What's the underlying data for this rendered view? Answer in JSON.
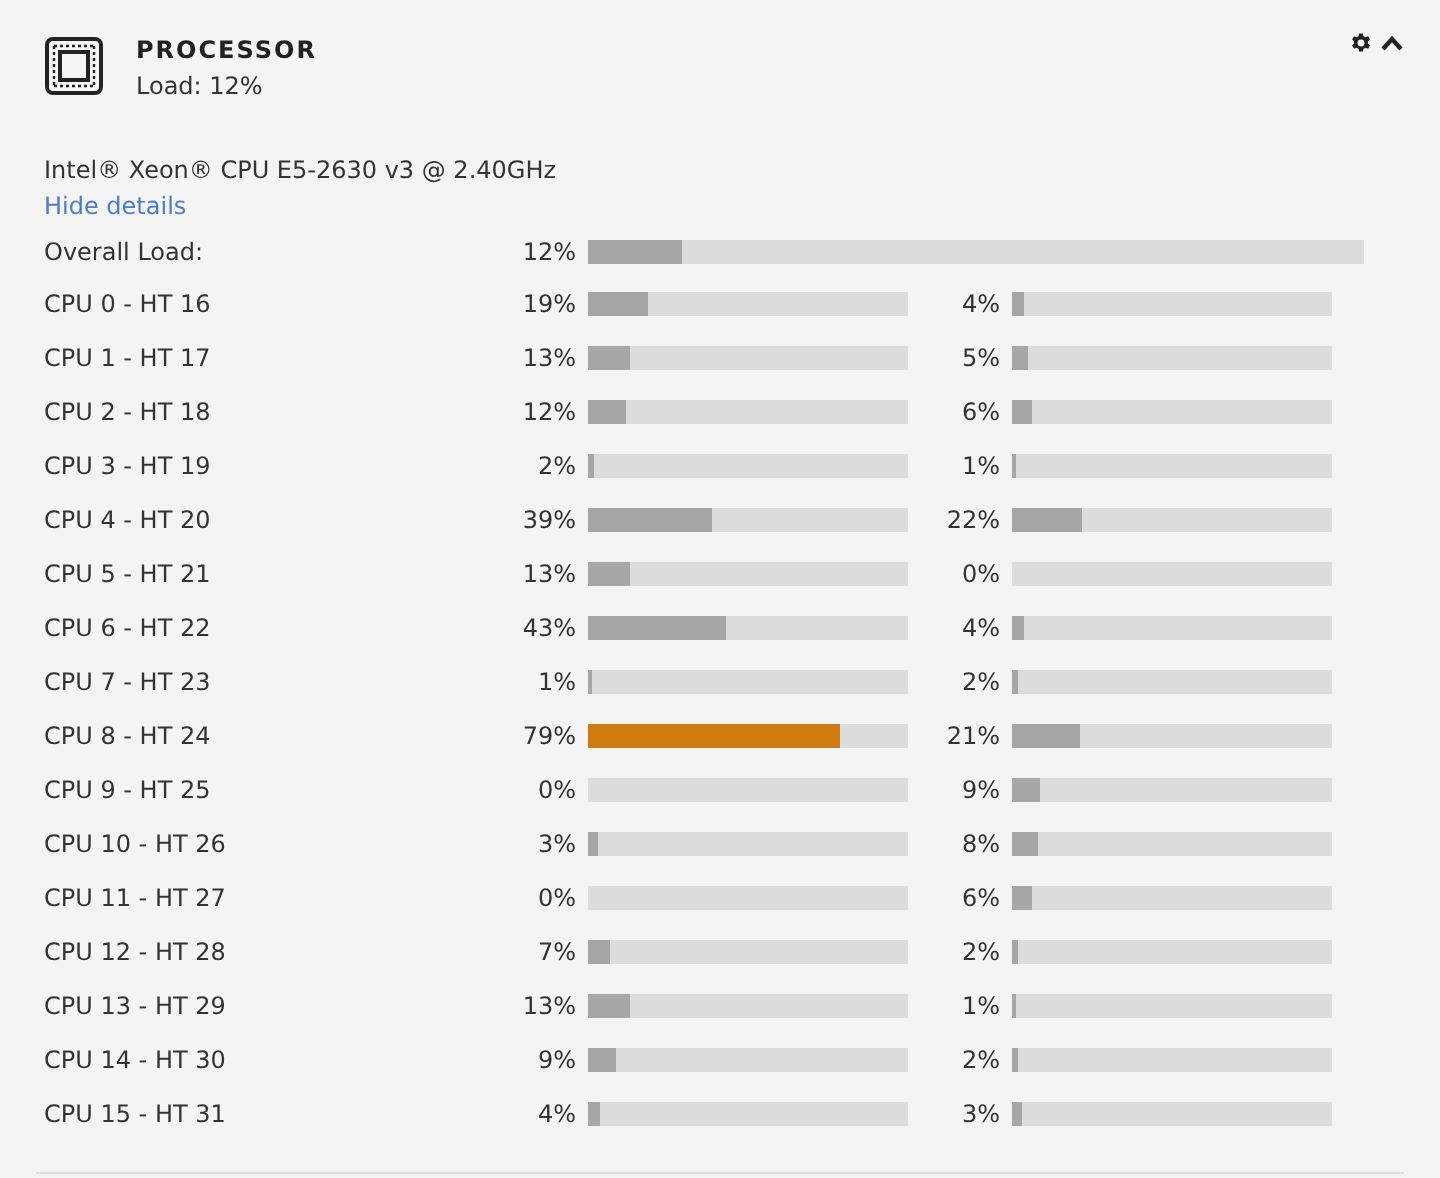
{
  "header": {
    "title": "PROCESSOR",
    "subtitle": "Load: 12%"
  },
  "cpu_model": "Intel® Xeon® CPU E5-2630 v3 @ 2.40GHz",
  "details_link": "Hide details",
  "overall": {
    "label": "Overall Load:",
    "reading": "12%",
    "level": 0.12
  },
  "cpus": [
    {
      "label": "CPU 0 - HT 16",
      "core": {
        "reading": "19%",
        "level": 0.19
      },
      "ht": {
        "reading": "4%",
        "level": 0.04
      }
    },
    {
      "label": "CPU 1 - HT 17",
      "core": {
        "reading": "13%",
        "level": 0.13
      },
      "ht": {
        "reading": "5%",
        "level": 0.05
      }
    },
    {
      "label": "CPU 2 - HT 18",
      "core": {
        "reading": "12%",
        "level": 0.12
      },
      "ht": {
        "reading": "6%",
        "level": 0.06
      }
    },
    {
      "label": "CPU 3 - HT 19",
      "core": {
        "reading": "2%",
        "level": 0.02
      },
      "ht": {
        "reading": "1%",
        "level": 0.01
      }
    },
    {
      "label": "CPU 4 - HT 20",
      "core": {
        "reading": "39%",
        "level": 0.39
      },
      "ht": {
        "reading": "22%",
        "level": 0.22
      }
    },
    {
      "label": "CPU 5 - HT 21",
      "core": {
        "reading": "13%",
        "level": 0.13
      },
      "ht": {
        "reading": "0%",
        "level": 0
      }
    },
    {
      "label": "CPU 6 - HT 22",
      "core": {
        "reading": "43%",
        "level": 0.43
      },
      "ht": {
        "reading": "4%",
        "level": 0.04
      }
    },
    {
      "label": "CPU 7 - HT 23",
      "core": {
        "reading": "1%",
        "level": 0.01
      },
      "ht": {
        "reading": "2%",
        "level": 0.02
      }
    },
    {
      "label": "CPU 8 - HT 24",
      "core": {
        "reading": "79%",
        "level": 0.79
      },
      "ht": {
        "reading": "21%",
        "level": 0.21
      }
    },
    {
      "label": "CPU 9 - HT 25",
      "core": {
        "reading": "0%",
        "level": 0
      },
      "ht": {
        "reading": "9%",
        "level": 0.09
      }
    },
    {
      "label": "CPU 10 - HT 26",
      "core": {
        "reading": "3%",
        "level": 0.03
      },
      "ht": {
        "reading": "8%",
        "level": 0.08
      }
    },
    {
      "label": "CPU 11 - HT 27",
      "core": {
        "reading": "0%",
        "level": 0
      },
      "ht": {
        "reading": "6%",
        "level": 0.06
      }
    },
    {
      "label": "CPU 12 - HT 28",
      "core": {
        "reading": "7%",
        "level": 0.07
      },
      "ht": {
        "reading": "2%",
        "level": 0.02
      }
    },
    {
      "label": "CPU 13 - HT 29",
      "core": {
        "reading": "13%",
        "level": 0.13
      },
      "ht": {
        "reading": "1%",
        "level": 0.01
      }
    },
    {
      "label": "CPU 14 - HT 30",
      "core": {
        "reading": "9%",
        "level": 0.09
      },
      "ht": {
        "reading": "2%",
        "level": 0.02
      }
    },
    {
      "label": "CPU 15 - HT 31",
      "core": {
        "reading": "4%",
        "level": 0.04
      },
      "ht": {
        "reading": "3%",
        "level": 0.03
      }
    }
  ]
}
